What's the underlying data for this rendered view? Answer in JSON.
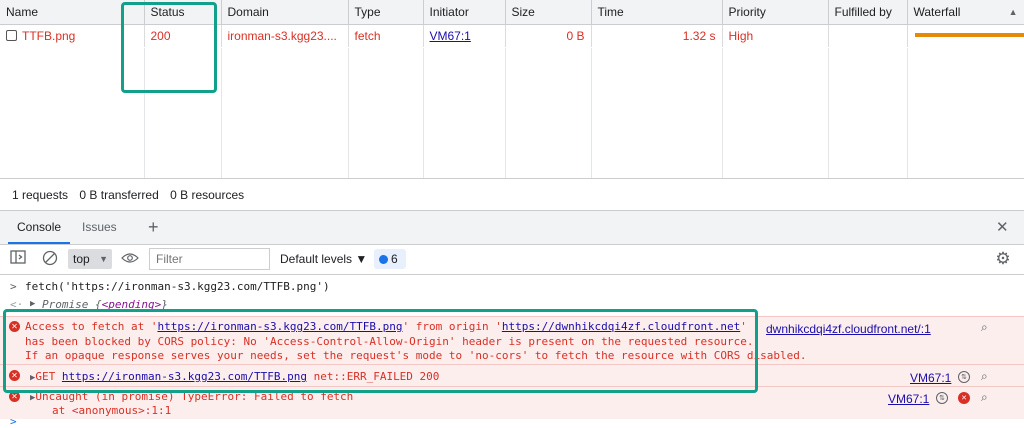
{
  "network": {
    "columns": [
      "Name",
      "Status",
      "Domain",
      "Type",
      "Initiator",
      "Size",
      "Time",
      "Priority",
      "Fulfilled by",
      "Waterfall"
    ],
    "row": {
      "name": "TTFB.png",
      "status": "200",
      "domain": "ironman-s3.kgg23....",
      "type": "fetch",
      "initiator": "VM67:1",
      "size": "0 B",
      "time": "1.32 s",
      "priority": "High",
      "fulfilled_by": ""
    },
    "summary": {
      "requests": "1 requests",
      "transferred": "0 B transferred",
      "resources": "0 B resources"
    }
  },
  "drawer": {
    "tabs": [
      "Console",
      "Issues"
    ],
    "add_tab": "+",
    "close": "✕"
  },
  "toolbar": {
    "context": "top",
    "filter_placeholder": "Filter",
    "levels": "Default levels ▼",
    "badge_count": "6"
  },
  "console": {
    "input_cmd": "fetch('https://ironman-s3.kgg23.com/TTFB.png')",
    "promise_prefix": "Promise {",
    "promise_state": "<pending>",
    "promise_suffix": "}",
    "cors": {
      "l1_pre": "Access to fetch at '",
      "l1_url": "https://ironman-s3.kgg23.com/TTFB.png",
      "l1_mid": "' from origin '",
      "l1_origin": "https://dwnhikcdqi4zf.cloudfront.net",
      "l1_post": "'",
      "l2": "has been blocked by CORS policy: No 'Access-Control-Allow-Origin' header is present on the requested resource.",
      "l3": "If an opaque response serves your needs, set the request's mode to 'no-cors' to fetch the resource with CORS disabled.",
      "source": "dwnhikcdqi4zf.cloudfront.net/:1"
    },
    "get": {
      "method": "GET",
      "url": "https://ironman-s3.kgg23.com/TTFB.png",
      "status": "net::ERR_FAILED 200",
      "source": "VM67:1"
    },
    "uncaught": {
      "l1": "Uncaught (in promise) TypeError: Failed to fetch",
      "l2": "at <anonymous>:1:1",
      "source": "VM67:1"
    }
  },
  "colors": {
    "error": "#d93025",
    "highlight": "#13a08a",
    "waterfall": "#e38b06",
    "link": "#1a0dab"
  }
}
